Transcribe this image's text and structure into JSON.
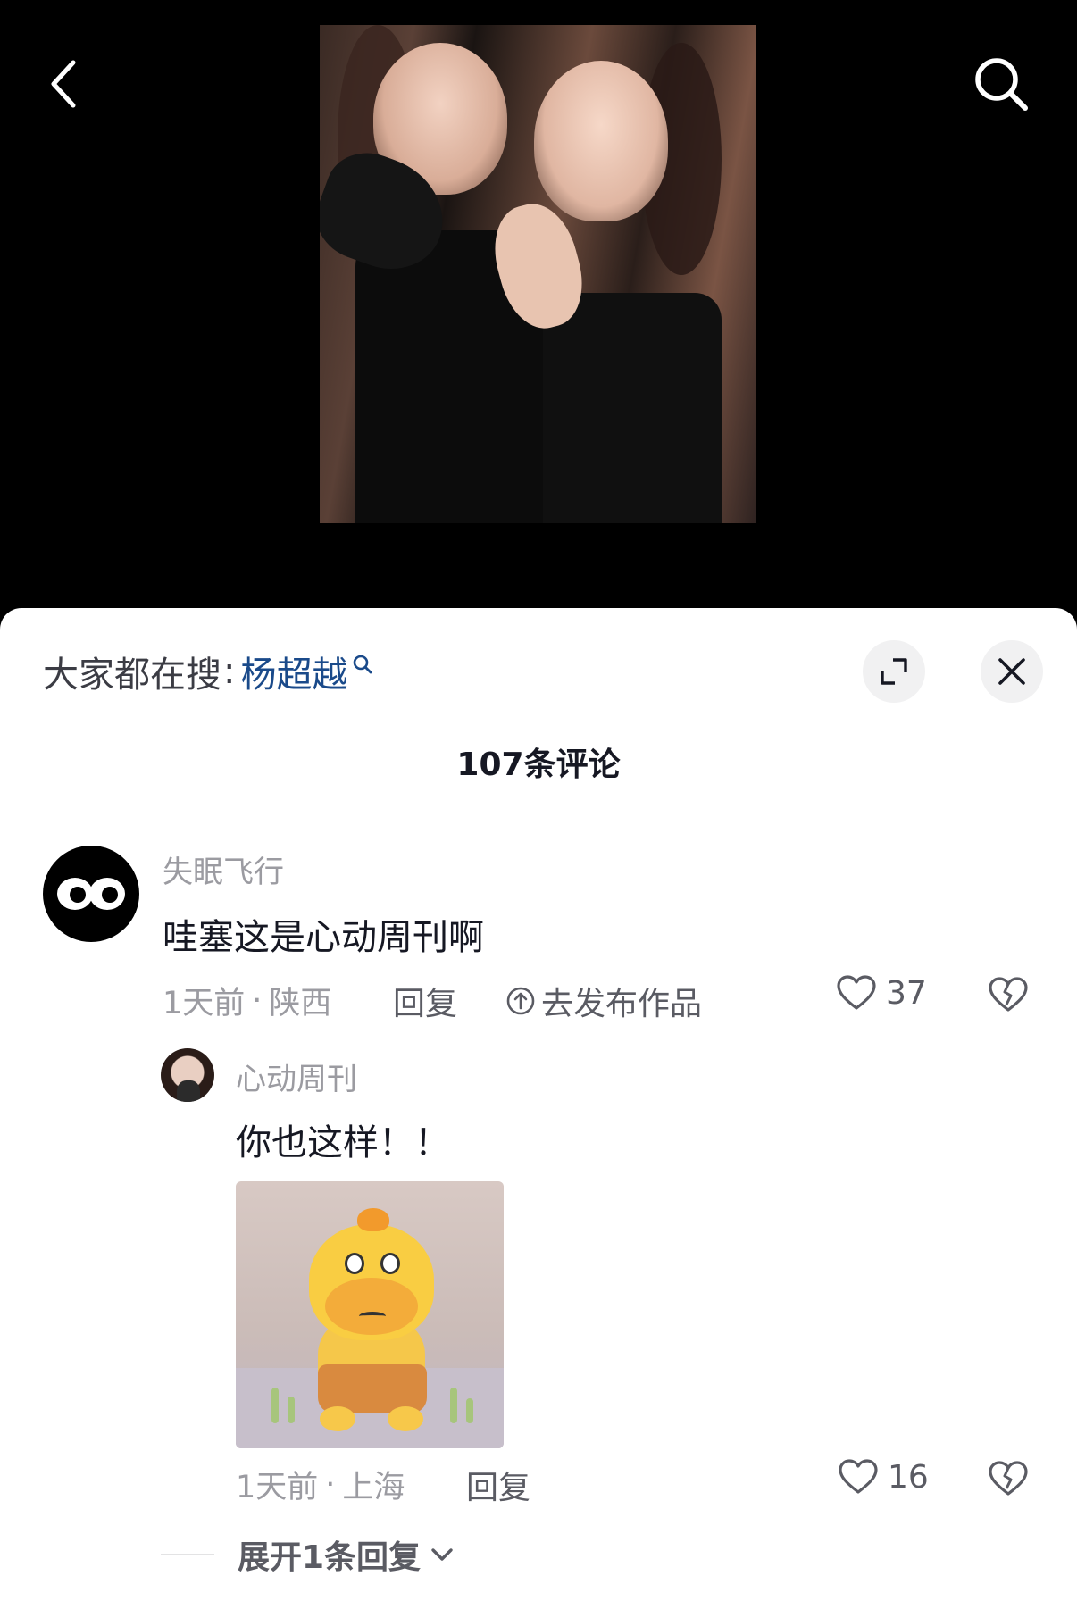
{
  "video": {
    "description_icon": "video-thumbnail"
  },
  "nav": {
    "back_icon": "chevron-left-icon",
    "search_icon": "search-icon"
  },
  "suggest": {
    "label": "大家都在搜",
    "colon": ":",
    "term": "杨超越"
  },
  "comments_count": "107条评论",
  "comment": {
    "username": "失眠飞行",
    "text": "哇塞这是心动周刊啊",
    "time": "1天前",
    "dot": "·",
    "location": "陕西",
    "reply_label": "回复",
    "publish_label": "去发布作品",
    "likes": "37"
  },
  "reply": {
    "username": "心动周刊",
    "text": "你也这样！！",
    "time": "1天前",
    "dot": "·",
    "location": "上海",
    "reply_label": "回复",
    "likes": "16"
  },
  "expand_replies": "展开1条回复",
  "colors": {
    "link_blue": "#1a4a8a",
    "gray_text": "#9b9ba1",
    "sheet_bg": "#ffffff"
  }
}
